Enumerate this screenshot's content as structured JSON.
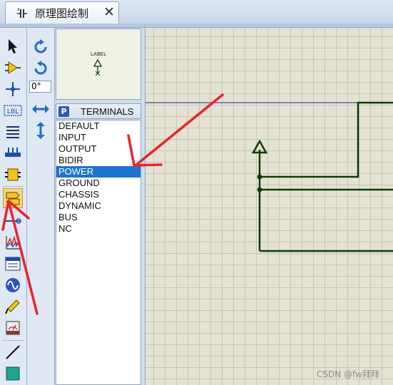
{
  "tab": {
    "title": "原理图绘制",
    "close": "✕",
    "icon": "schematic-icon"
  },
  "toolbar": {
    "tools": [
      "select-arrow-icon",
      "component-icon",
      "junction-icon",
      "wire-label-icon",
      "text-script-icon",
      "bus-icon",
      "subcircuit-icon",
      "terminal-icon",
      "pin-icon",
      "graph-icon",
      "tape-icon",
      "generator-icon",
      "probe-icon",
      "instrument-icon",
      "line-icon",
      "box-icon"
    ],
    "active_tool": "terminal-icon",
    "label_icon_text": "LBL"
  },
  "toolbar2": {
    "rotate_cw": "rotate-clockwise-icon",
    "rotate_ccw": "rotate-anticlockwise-icon",
    "angle": "0°",
    "flip_h": "flip-horizontal-icon",
    "flip_v": "flip-vertical-icon"
  },
  "preview": {
    "label": "LABEL"
  },
  "terminals": {
    "button": "P",
    "title": "TERMINALS",
    "items": [
      "DEFAULT",
      "INPUT",
      "OUTPUT",
      "BIDIR",
      "POWER",
      "GROUND",
      "CHASSIS",
      "DYNAMIC",
      "BUS",
      "NC"
    ],
    "selected": "POWER"
  },
  "colors": {
    "wire": "#004400",
    "selection": "#1d75d0",
    "arrow": "#e8242c",
    "canvas": "#e4e3d3",
    "grid": "#c7c6b4"
  },
  "watermark": "CSDN @fw拜拜"
}
